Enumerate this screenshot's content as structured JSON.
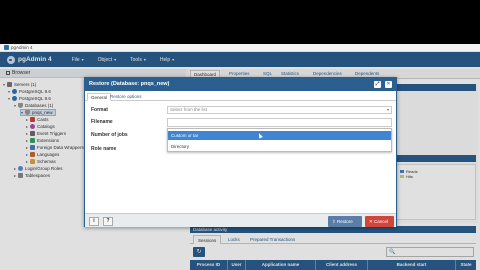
{
  "window": {
    "title": "pgAdmin 4"
  },
  "menubar": {
    "brand": "pgAdmin 4",
    "menus": [
      "File",
      "Object",
      "Tools",
      "Help"
    ]
  },
  "browser": {
    "title": "Browser",
    "tree": [
      {
        "label": "Servers (1)",
        "toggle": "▾"
      },
      {
        "label": "PostgreSQL 9.6",
        "toggle": "▾"
      },
      {
        "label": "PostgreSQL 9.6",
        "toggle": "▾"
      },
      {
        "label": "Databases (1)",
        "toggle": "▾"
      },
      {
        "label": "pnqs_new",
        "toggle": "▾"
      },
      {
        "label": "Casts",
        "toggle": "▸"
      },
      {
        "label": "Catalogs",
        "toggle": "▸"
      },
      {
        "label": "Event Triggers",
        "toggle": "▸"
      },
      {
        "label": "Extensions",
        "toggle": "▸"
      },
      {
        "label": "Foreign Data Wrappers",
        "toggle": "▸"
      },
      {
        "label": "Languages",
        "toggle": "▸"
      },
      {
        "label": "Schemas",
        "toggle": "▸"
      },
      {
        "label": "Login/Group Roles",
        "toggle": "▸"
      },
      {
        "label": "Tablespaces",
        "toggle": "▸"
      }
    ]
  },
  "right_tabs": [
    "Dashboard",
    "Properties",
    "SQL",
    "Statistics",
    "Dependencies",
    "Dependents"
  ],
  "stats_chart": {
    "title_suffix": "ns",
    "legend": [
      {
        "label": "Reads",
        "color": "#4a7fbf"
      },
      {
        "label": "Hits",
        "color": "#c8d86a"
      }
    ]
  },
  "activity": {
    "title": "Database activity",
    "tabs": [
      "Sessions",
      "Locks",
      "Prepared Transactions"
    ],
    "search_icon": "🔍",
    "columns": [
      "Process ID",
      "User",
      "Application name",
      "Client address",
      "Backend start",
      "State"
    ]
  },
  "dialog": {
    "title": "Restore (Database: pnqs_new)",
    "tabs": [
      "General",
      "Restore options"
    ],
    "fields": {
      "format_label": "Format",
      "format_placeholder": "Select from the list",
      "filename_label": "Filename",
      "jobs_label": "Number of jobs",
      "role_label": "Role name"
    },
    "dropdown_options": [
      "Custom or tar",
      "Directory"
    ],
    "footer": {
      "info": "i",
      "help": "?",
      "restore": "Restore",
      "cancel": "Cancel"
    }
  },
  "colors": {
    "accent": "#2b5f8f",
    "highlight": "#3f85d1",
    "cancel": "#d0463a"
  }
}
